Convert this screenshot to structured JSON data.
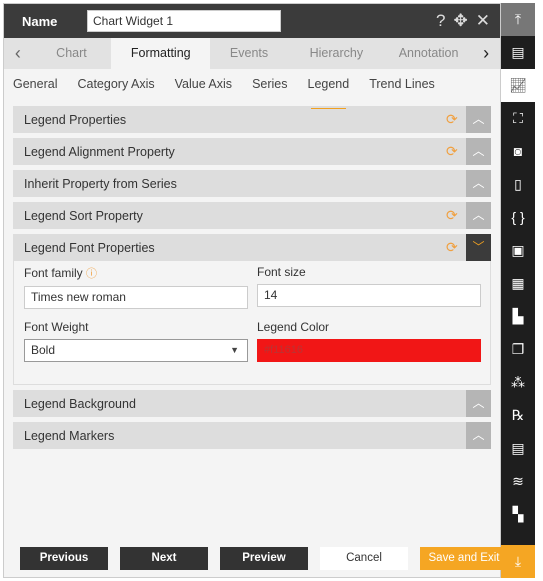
{
  "header": {
    "name_label": "Name",
    "name_value": "Chart Widget 1",
    "help": "?",
    "move": "✥",
    "close": "✕"
  },
  "tabs": [
    {
      "label": "Chart"
    },
    {
      "label": "Formatting",
      "active": true
    },
    {
      "label": "Events"
    },
    {
      "label": "Hierarchy"
    },
    {
      "label": "Annotation"
    }
  ],
  "subtabs": [
    {
      "label": "General"
    },
    {
      "label": "Category Axis"
    },
    {
      "label": "Value Axis"
    },
    {
      "label": "Series"
    },
    {
      "label": "Legend",
      "active": true
    },
    {
      "label": "Trend Lines"
    }
  ],
  "sections": [
    {
      "title": "Legend Properties",
      "refresh": true
    },
    {
      "title": "Legend Alignment Property",
      "refresh": true
    },
    {
      "title": "Inherit Property from Series",
      "refresh": false
    },
    {
      "title": "Legend Sort Property",
      "refresh": true
    },
    {
      "title": "Legend Font Properties",
      "refresh": true,
      "expanded": true
    },
    {
      "title": "Legend Background",
      "refresh": false
    },
    {
      "title": "Legend Markers",
      "refresh": false
    }
  ],
  "font": {
    "family_label": "Font family",
    "family_value": "Times new roman",
    "size_label": "Font size",
    "size_value": "14",
    "weight_label": "Font Weight",
    "weight_value": "Bold",
    "color_label": "Legend Color",
    "color_value": "#f11616"
  },
  "footer": {
    "previous": "Previous",
    "next": "Next",
    "preview": "Preview",
    "cancel": "Cancel",
    "save": "Save and Exit"
  },
  "colors": {
    "accent": "#f5a623",
    "legend_color": "#f11616",
    "header": "#3b3b3b"
  },
  "sidebar_icons": [
    "scroll-top-icon",
    "widget-icon",
    "chart-icon",
    "map-icon",
    "report-icon",
    "document-icon",
    "code-icon",
    "image-icon",
    "table-icon",
    "bar-chart-icon",
    "copy-icon",
    "cubes-icon",
    "rx-icon",
    "form-icon",
    "layers-icon",
    "grid-icon",
    "download-icon"
  ]
}
